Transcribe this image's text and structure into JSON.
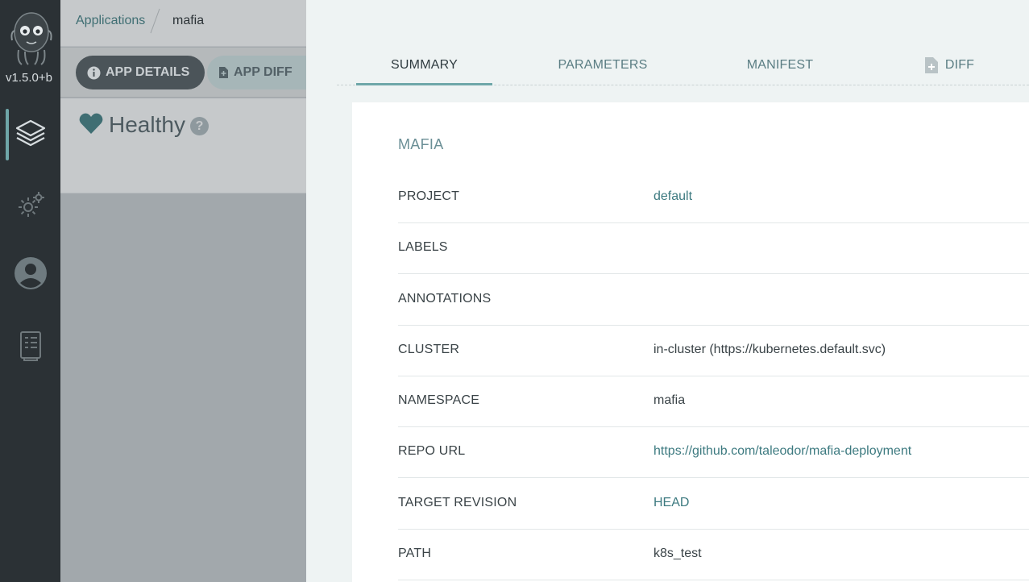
{
  "nav": {
    "version": "v1.5.0+b",
    "items": [
      {
        "name": "applications",
        "icon": "layers-icon"
      },
      {
        "name": "settings",
        "icon": "gear-icon"
      },
      {
        "name": "user-info",
        "icon": "user-icon"
      },
      {
        "name": "documentation",
        "icon": "docs-icon"
      }
    ]
  },
  "breadcrumb": {
    "root": "Applications",
    "current": "mafia"
  },
  "toolbar": {
    "app_details_label": "APP DETAILS",
    "app_diff_label": "APP DIFF"
  },
  "status": {
    "health": "Healthy",
    "help": "?"
  },
  "tabs": {
    "summary": "SUMMARY",
    "parameters": "PARAMETERS",
    "manifest": "MANIFEST",
    "diff": "DIFF"
  },
  "summary": {
    "app_name": "MAFIA",
    "rows": [
      {
        "label": "PROJECT",
        "value": "default",
        "link": true
      },
      {
        "label": "LABELS",
        "value": "",
        "link": false
      },
      {
        "label": "ANNOTATIONS",
        "value": "",
        "link": false
      },
      {
        "label": "CLUSTER",
        "value": "in-cluster (https://kubernetes.default.svc)",
        "link": false
      },
      {
        "label": "NAMESPACE",
        "value": "mafia",
        "link": false
      },
      {
        "label": "REPO URL",
        "value": "https://github.com/taleodor/mafia-deployment",
        "link": true
      },
      {
        "label": "TARGET REVISION",
        "value": "HEAD",
        "link": true
      },
      {
        "label": "PATH",
        "value": "k8s_test",
        "link": false
      }
    ]
  },
  "colors": {
    "accent": "#6fa7a9",
    "link": "#3d7a80",
    "nav_bg": "#2b3135",
    "health": "#3f6e73"
  }
}
